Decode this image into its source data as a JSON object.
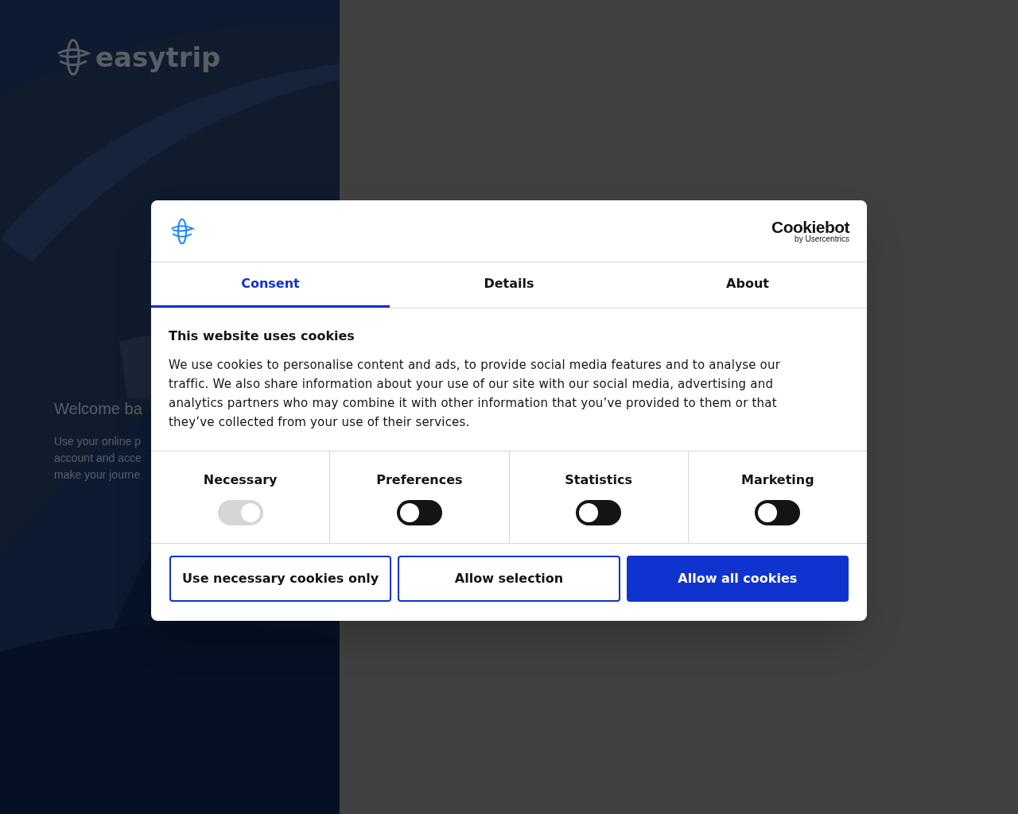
{
  "background": {
    "brand": "easytrip",
    "welcome_title": "Welcome ba",
    "welcome_lines": [
      "Use your online p",
      "account and acce",
      "make your journe"
    ]
  },
  "dialog": {
    "brand_title": "Cookiebot",
    "brand_subtitle": "by Usercentrics",
    "tabs": [
      {
        "label": "Consent",
        "selected": true
      },
      {
        "label": "Details",
        "selected": false
      },
      {
        "label": "About",
        "selected": false
      }
    ],
    "heading": "This website uses cookies",
    "text": "We use cookies to personalise content and ads, to provide social media features and to analyse our traffic. We also share information about your use of our site with our social media, advertising and analytics partners who may combine it with other information that you’ve provided to them or that they’ve collected from your use of their services.",
    "categories": [
      {
        "label": "Necessary",
        "on": true,
        "disabled": true
      },
      {
        "label": "Preferences",
        "on": false,
        "disabled": false
      },
      {
        "label": "Statistics",
        "on": false,
        "disabled": false
      },
      {
        "label": "Marketing",
        "on": false,
        "disabled": false
      }
    ],
    "buttons": [
      {
        "label": "Use necessary cookies only",
        "kind": "outline"
      },
      {
        "label": "Allow selection",
        "kind": "outline"
      },
      {
        "label": "Allow all cookies",
        "kind": "primary"
      }
    ]
  }
}
